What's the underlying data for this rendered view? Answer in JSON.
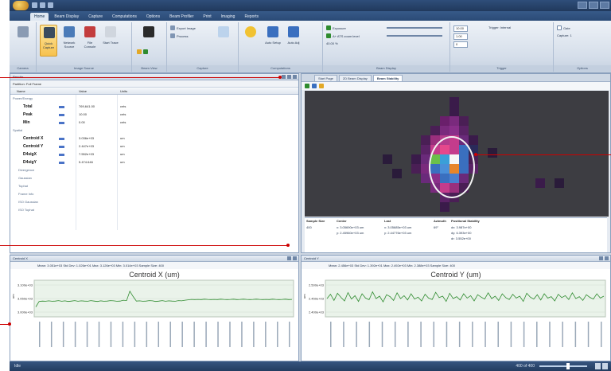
{
  "ribbon": {
    "tabs": [
      "Home",
      "Beam Display",
      "Capture",
      "Computations",
      "Options",
      "Beam Profiler",
      "Print",
      "Imaging",
      "Reports"
    ],
    "active_tab": "Home",
    "buttons": [
      {
        "label": "",
        "icon": "beam-profiler-icon"
      },
      {
        "label": "Quick Capture",
        "icon": "camera-icon"
      },
      {
        "label": "Network Source",
        "icon": "network-icon"
      },
      {
        "label": "File Console",
        "icon": "file-icon"
      },
      {
        "label": "Start Trace",
        "icon": "trace-icon"
      }
    ],
    "small_items": [
      "Export Image",
      "Process",
      "Auto Setup",
      "Auto Adj",
      "Exposure",
      "A+ ATS zoom level",
      "40.00 %",
      "Trigger: Internal",
      "Gate",
      "Capture: 1"
    ],
    "spin_values": [
      "10.00",
      "1.00",
      "0"
    ],
    "group_labels": [
      "Camera",
      "Image Source",
      "Beam View",
      "Capture",
      "Computations",
      "Beam Display",
      "Trigger",
      "Options"
    ]
  },
  "left_panel": {
    "title": "Results",
    "filter_label": "Partition: Full Frame",
    "columns": [
      "Name",
      "Value",
      "Units"
    ],
    "rows": [
      {
        "name": "Power/Energy",
        "value": "",
        "unit": "",
        "kind": "category"
      },
      {
        "name": "Total",
        "value": "769,641.00",
        "unit": "cnts",
        "kind": "bold"
      },
      {
        "name": "Peak",
        "value": "10.00",
        "unit": "cnts",
        "kind": "bold"
      },
      {
        "name": "Min",
        "value": "0.00",
        "unit": "cnts",
        "kind": "bold"
      },
      {
        "name": "Spatial",
        "value": "",
        "unit": "",
        "kind": "category"
      },
      {
        "name": "Centroid X",
        "value": "3.036e+03",
        "unit": "um",
        "kind": "bold"
      },
      {
        "name": "Centroid Y",
        "value": "2.447e+03",
        "unit": "um",
        "kind": "bold"
      },
      {
        "name": "D4sigX",
        "value": "7.552e+03",
        "unit": "um",
        "kind": "bold"
      },
      {
        "name": "D4sigY",
        "value": "5.474.646",
        "unit": "um",
        "kind": "bold"
      },
      {
        "name": "Divergence",
        "value": "",
        "unit": "",
        "kind": "sub"
      },
      {
        "name": "Gaussian",
        "value": "",
        "unit": "",
        "kind": "sub"
      },
      {
        "name": "Tophat",
        "value": "",
        "unit": "",
        "kind": "sub"
      },
      {
        "name": "Frame Info",
        "value": "",
        "unit": "",
        "kind": "sub"
      },
      {
        "name": "ISO Gaussian",
        "value": "",
        "unit": "",
        "kind": "sub"
      },
      {
        "name": "ISO Tophat",
        "value": "",
        "unit": "",
        "kind": "sub"
      }
    ]
  },
  "right_panel": {
    "tabs": [
      "Start Page",
      "2D Beam Display",
      "Beam Stability"
    ],
    "active_tab": "Beam Stability",
    "stats": {
      "headers": [
        "Sample Size",
        "Center",
        "Last",
        "Azimuth",
        "Positional Stability"
      ],
      "sample_size": "400",
      "center": [
        "x: 3.05690e+03 um",
        "y: 2.45960e+03 um"
      ],
      "last": [
        "x: 3.05685e+03 um",
        "y: 2.44776e+03 um"
      ],
      "azimuth": "69°",
      "stability": [
        "dx: 3.987e+00",
        "dy: 6.393e+00",
        "dr: 3.552e+00"
      ]
    }
  },
  "bottom_left": {
    "panel_title": "Centroid X",
    "stats_line": "Mean: 3.051e+03  Std Dev: 1.026e+01  Max: 3.126e+03  Min: 3.014e+03  Sample Size: 400",
    "chart_title": "Centroid X (um)"
  },
  "bottom_right": {
    "panel_title": "Centroid Y",
    "stats_line": "Mean: 2.456e+03  Std Dev: 1.392e+01  Max: 2.492e+03  Min: 2.388e+03  Sample Size: 400",
    "chart_title": "Centroid Y (um)"
  },
  "status_bar": {
    "left": "Idle",
    "right": "400 of 400"
  },
  "colors": {
    "callout": "#cc0000",
    "trace": "#2e8b2e",
    "heatmap_bg": "#3d3d42"
  },
  "chart_data": [
    {
      "type": "line",
      "title": "Centroid X (um)",
      "xlabel": "",
      "ylabel": "um",
      "y_ticks": [
        "3.100e+03",
        "3.050e+03",
        "3.000e+03"
      ],
      "ylim": [
        2980,
        3140
      ],
      "series": [
        {
          "values": [
            3020,
            3046,
            3048,
            3047,
            3049,
            3047,
            3048,
            3050,
            3047,
            3049,
            3046,
            3048,
            3050,
            3047,
            3049,
            3048,
            3047,
            3050,
            3048,
            3046,
            3049,
            3047,
            3048,
            3050,
            3049,
            3047,
            3048,
            3052,
            3050,
            3095,
            3070,
            3048,
            3049,
            3047,
            3048,
            3050,
            3049,
            3046,
            3048,
            3050,
            3047,
            3049,
            3048,
            3047,
            3050,
            3049,
            3052,
            3054,
            3056,
            3055,
            3056,
            3055,
            3057,
            3056,
            3055,
            3056,
            3055,
            3057,
            3056,
            3055,
            3056,
            3057,
            3055,
            3056,
            3057,
            3056,
            3055,
            3056,
            3057,
            3056,
            3055,
            3056,
            3055,
            3057,
            3056,
            3055,
            3056,
            3057,
            3055,
            3056
          ]
        }
      ]
    },
    {
      "type": "line",
      "title": "Centroid Y (um)",
      "xlabel": "",
      "ylabel": "um",
      "y_ticks": [
        "2.500e+03",
        "2.450e+03",
        "2.400e+03"
      ],
      "ylim": [
        2380,
        2520
      ],
      "series": [
        {
          "values": [
            2450,
            2468,
            2442,
            2472,
            2455,
            2440,
            2475,
            2448,
            2462,
            2438,
            2470,
            2452,
            2445,
            2478,
            2450,
            2460,
            2436,
            2466,
            2458,
            2442,
            2474,
            2450,
            2462,
            2444,
            2470,
            2448,
            2456,
            2440,
            2468,
            2452,
            2446,
            2476,
            2454,
            2460,
            2438,
            2472,
            2450,
            2458,
            2444,
            2470,
            2452,
            2462,
            2440,
            2466,
            2456,
            2448,
            2474,
            2450,
            2460,
            2442,
            2470,
            2454,
            2446,
            2468,
            2452,
            2460,
            2438,
            2472,
            2456,
            2448,
            2466,
            2444,
            2470,
            2452,
            2458,
            2440,
            2468,
            2454,
            2462,
            2446,
            2474,
            2450,
            2458,
            2442,
            2466,
            2455,
            2448,
            2470,
            2452,
            2460
          ]
        }
      ]
    }
  ]
}
